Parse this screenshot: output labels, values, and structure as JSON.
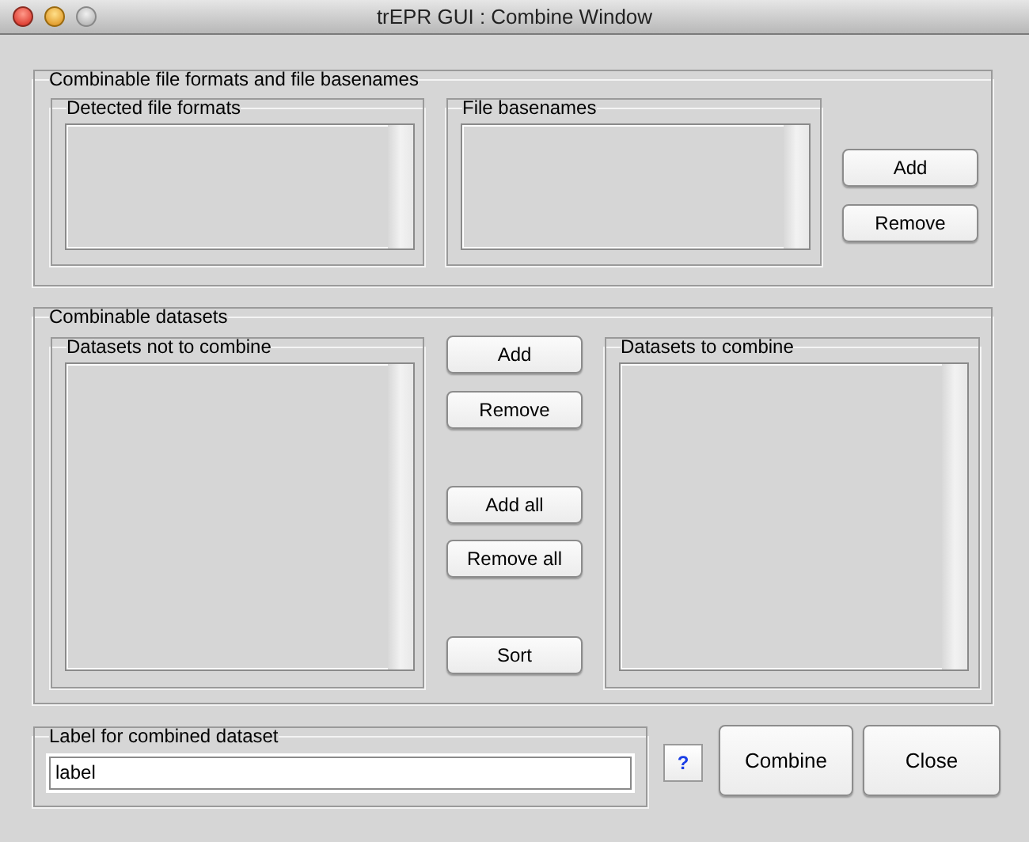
{
  "window": {
    "title": "trEPR GUI : Combine Window"
  },
  "formats_panel": {
    "title": "Combinable file formats and file basenames",
    "detected": {
      "title": "Detected file formats"
    },
    "basenames": {
      "title": "File basenames"
    },
    "buttons": [
      "Add",
      "Remove"
    ]
  },
  "datasets_panel": {
    "title": "Combinable datasets",
    "left": {
      "title": "Datasets not to combine"
    },
    "right": {
      "title": "Datasets to combine"
    },
    "buttons": [
      "Add",
      "Remove",
      "Add all",
      "Remove all",
      "Sort"
    ]
  },
  "label_panel": {
    "title": "Label for combined dataset",
    "value": "label"
  },
  "help_button": "?",
  "buttons": [
    "Combine",
    "Close"
  ]
}
